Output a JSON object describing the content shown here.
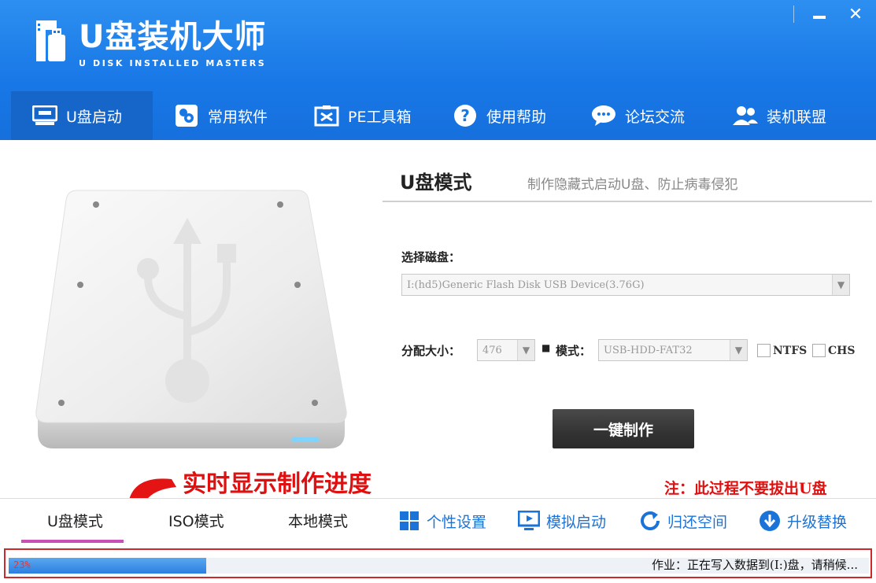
{
  "window": {
    "min_label": "—",
    "close_label": "✕"
  },
  "logo": {
    "title": "U盘装机大师",
    "subtitle": "U DISK INSTALLED MASTERS"
  },
  "nav": {
    "items": [
      {
        "label": "U盘启动",
        "icon": "usb-drive-icon",
        "active": true
      },
      {
        "label": "常用软件",
        "icon": "software-icon"
      },
      {
        "label": "PE工具箱",
        "icon": "toolbox-icon"
      },
      {
        "label": "使用帮助",
        "icon": "help-icon"
      },
      {
        "label": "论坛交流",
        "icon": "chat-icon"
      },
      {
        "label": "装机联盟",
        "icon": "users-icon"
      }
    ]
  },
  "mode": {
    "title": "U盘模式",
    "description": "制作隐藏式启动U盘、防止病毒侵犯"
  },
  "form": {
    "disk_label": "选择磁盘：",
    "disk_value": "I:(hd5)Generic Flash Disk USB Device(3.76G)",
    "alloc_label": "分配大小：",
    "alloc_value": "476",
    "mode_label": "模式：",
    "mode_value": "USB-HDD-FAT32",
    "ntfs_label": "NTFS",
    "chs_label": "CHS"
  },
  "make_button": "一键制作",
  "annotations": {
    "progress_note": "实时显示制作进度",
    "warning": "注：此过程不要拔出U盘"
  },
  "bottom_tabs": {
    "modes": [
      {
        "label": "U盘模式",
        "active": true
      },
      {
        "label": "ISO模式"
      },
      {
        "label": "本地模式"
      }
    ],
    "tools": [
      {
        "label": "个性设置",
        "icon": "grid-icon"
      },
      {
        "label": "模拟启动",
        "icon": "monitor-icon"
      },
      {
        "label": "归还空间",
        "icon": "refresh-icon"
      },
      {
        "label": "升级替换",
        "icon": "download-icon"
      }
    ]
  },
  "status": {
    "progress_percent": 23,
    "progress_label": "23%",
    "message": "作业：正在写入数据到(I:)盘，请稍候..."
  },
  "colors": {
    "header": "#1877e6",
    "accent_red": "#e01010",
    "link_blue": "#1a73d9",
    "tab_underline": "#c94eb8"
  }
}
